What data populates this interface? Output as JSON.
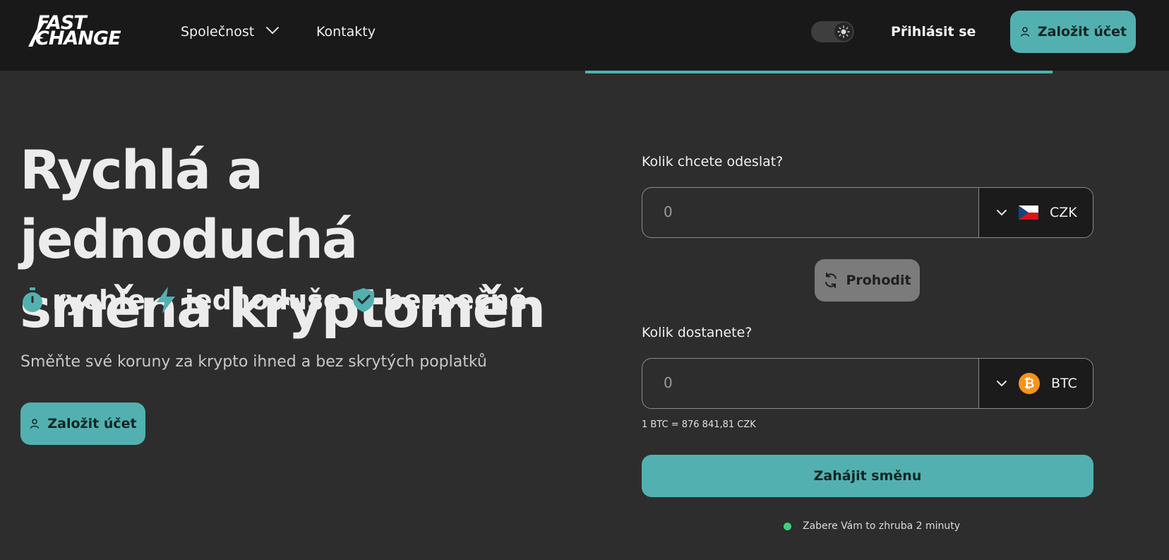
{
  "header": {
    "logo_line1": "FAST",
    "logo_line2": "CHANGE",
    "nav": [
      {
        "label": "Společnost"
      },
      {
        "label": "Kontakty"
      }
    ],
    "login_label": "Přihlásit se",
    "signup_label": "Založit účet"
  },
  "hero": {
    "title_line1": "Rychlá a jednoduchá",
    "title_line2": "směna kryptoměn",
    "features": [
      {
        "icon": "stopwatch-icon",
        "label": "rychle"
      },
      {
        "icon": "lightning-icon",
        "label": "jednoduše"
      },
      {
        "icon": "shield-check-icon",
        "label": "bezpečně"
      }
    ],
    "subtitle": "Směňte své koruny za krypto ihned a bez skrytých poplatků",
    "cta_label": "Založit účet"
  },
  "exchange": {
    "send_label": "Kolik chcete odeslat?",
    "send_value": "0",
    "send_currency": "CZK",
    "swap_label": "Prohodit",
    "receive_label": "Kolik dostanete?",
    "receive_value": "0",
    "receive_currency": "BTC",
    "rate": "1 BTC = 876 841,81 CZK",
    "start_label": "Zahájit směnu",
    "eta": "Zabere Vám to zhruba 2 minuty"
  },
  "colors": {
    "accent": "#52b1b0",
    "background": "#2d2d2d",
    "header_bg": "#191919",
    "status_green": "#3ccf7d",
    "bitcoin_orange": "#f7931a"
  }
}
